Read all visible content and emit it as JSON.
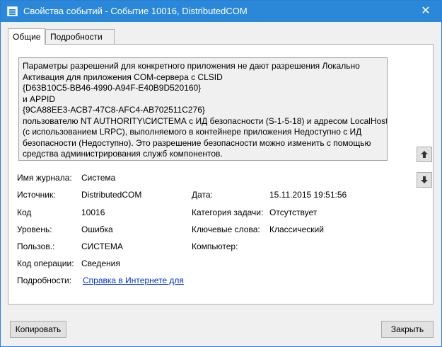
{
  "window": {
    "title": "Свойства событий - Событие 10016, DistributedCOM",
    "close_glyph": "✕"
  },
  "tabs": [
    {
      "label": "Общие"
    },
    {
      "label": "Подробности"
    }
  ],
  "message": {
    "lines": [
      "Параметры разрешений для конкретного приложения не дают разрешения Локально",
      "Активация для приложения COM-сервера с CLSID",
      "{D63B10C5-BB46-4990-A94F-E40B9D520160}",
      " и APPID",
      "{9CA88EE3-ACB7-47C8-AFC4-AB702511C276}",
      " пользователю NT AUTHORITY\\СИСТЕМА с ИД безопасности (S-1-5-18) и адресом LocalHost",
      "(с использованием LRPC), выполняемого в контейнере приложения Недоступно с ИД",
      "безопасности (Недоступно). Это разрешение безопасности можно изменить с помощью",
      "средства администрирования служб компонентов."
    ]
  },
  "fields": {
    "log_name": {
      "label": "Имя журнала:",
      "value": "Система"
    },
    "source": {
      "label": "Источник:",
      "value": "DistributedCOM"
    },
    "date": {
      "label": "Дата:",
      "value": "15.11.2015 19:51:56"
    },
    "code": {
      "label": "Код",
      "value": "10016"
    },
    "task_category": {
      "label": "Категория задачи:",
      "value": "Отсутствует"
    },
    "level": {
      "label": "Уровень:",
      "value": "Ошибка"
    },
    "keywords": {
      "label": "Ключевые слова:",
      "value": "Классический"
    },
    "user": {
      "label": "Пользов.:",
      "value": "СИСТЕМА"
    },
    "computer": {
      "label": "Компьютер:",
      "value": ""
    },
    "opcode": {
      "label": "Код операции:",
      "value": "Сведения"
    },
    "more_info": {
      "label": "Подробности:",
      "link": "Справка в Интернете для"
    }
  },
  "buttons": {
    "copy": "Копировать",
    "close": "Закрыть"
  }
}
